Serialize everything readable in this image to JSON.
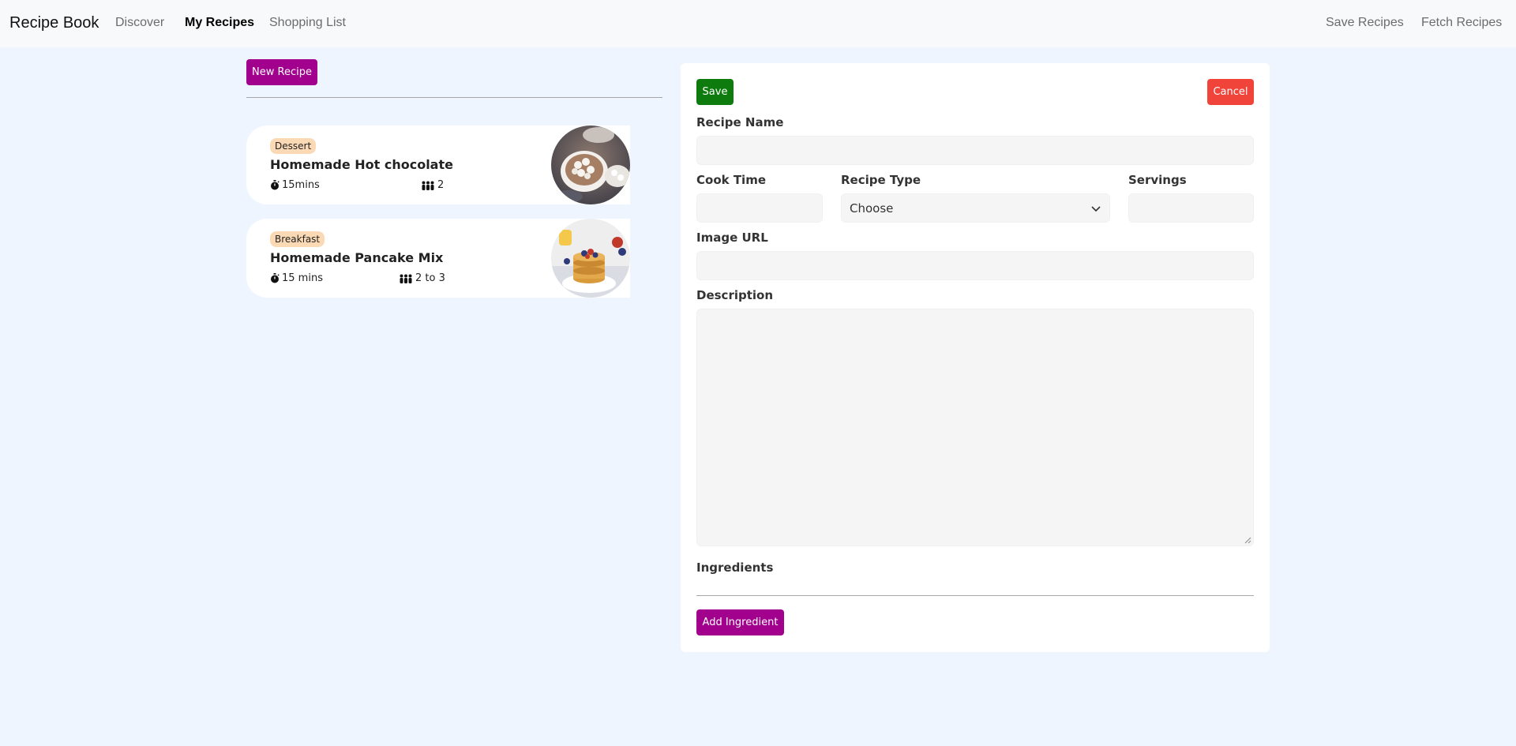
{
  "navbar": {
    "brand": "Recipe Book",
    "links": [
      {
        "label": "Discover",
        "active": false
      },
      {
        "label": "My Recipes",
        "active": true
      },
      {
        "label": "Shopping List",
        "active": false
      }
    ],
    "actions": [
      {
        "label": "Save Recipes"
      },
      {
        "label": "Fetch Recipes"
      }
    ]
  },
  "list": {
    "new_recipe_label": "New Recipe",
    "recipes": [
      {
        "category": "Dessert",
        "name": "Homemade Hot chocolate",
        "time": "15mins",
        "servings": "2",
        "image": "hot-chocolate-photo"
      },
      {
        "category": "Breakfast",
        "name": "Homemade Pancake Mix",
        "time": "15 mins",
        "servings": "2 to 3",
        "image": "pancake-stack-photo"
      }
    ]
  },
  "form": {
    "save_label": "Save",
    "cancel_label": "Cancel",
    "recipe_name_label": "Recipe Name",
    "recipe_name_value": "",
    "cook_time_label": "Cook Time",
    "cook_time_value": "",
    "recipe_type_label": "Recipe Type",
    "recipe_type_selected": "Choose",
    "servings_label": "Servings",
    "servings_value": "",
    "image_url_label": "Image URL",
    "image_url_value": "",
    "description_label": "Description",
    "description_value": "",
    "ingredients_label": "Ingredients",
    "add_ingredient_label": "Add Ingredient"
  },
  "colors": {
    "accent_purple": "#a1018c",
    "save_green": "#0e7b0e",
    "cancel_red": "#f0443a",
    "badge_bg": "#fbd9b5",
    "page_bg": "#eef5fe"
  }
}
